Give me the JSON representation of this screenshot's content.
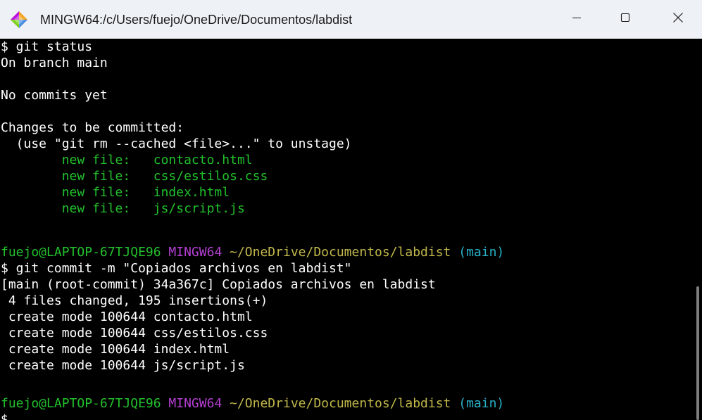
{
  "window": {
    "title": "MINGW64:/c/Users/fuejo/OneDrive/Documentos/labdist",
    "app_icon": "git-bash-icon",
    "controls": {
      "minimize": "minimize-icon",
      "maximize": "maximize-icon",
      "close": "close-icon"
    }
  },
  "colors": {
    "terminal_bg": "#000000",
    "text": "#ffffff",
    "green": "#22c02c",
    "magenta": "#b43fd2",
    "yellow": "#c2b84a",
    "cyan": "#27b1c9",
    "titlebar_bg": "#eef2f6"
  },
  "terminal": {
    "lines": [
      {
        "text": "$ git status"
      },
      {
        "text": "On branch main"
      },
      {
        "text": ""
      },
      {
        "text": "No commits yet"
      },
      {
        "text": ""
      },
      {
        "text": "Changes to be committed:"
      },
      {
        "text": "  (use \"git rm --cached <file>...\" to unstage)"
      },
      {
        "text": "        new file:   contacto.html"
      },
      {
        "text": "        new file:   css/estilos.css"
      },
      {
        "text": "        new file:   index.html"
      },
      {
        "text": "        new file:   js/script.js"
      },
      {
        "text": ""
      },
      {
        "text": ""
      },
      {
        "prompt_user": "fuejo@LAPTOP-67TJQE96",
        "prompt_system": "MINGW64",
        "prompt_path": "~/OneDrive/Documentos/labdist",
        "prompt_branch": "(main)"
      },
      {
        "text": "$ git commit -m \"Copiados archivos en labdist\""
      },
      {
        "text": "[main (root-commit) 34a367c] Copiados archivos en labdist"
      },
      {
        "text": " 4 files changed, 195 insertions(+)"
      },
      {
        "text": " create mode 100644 contacto.html"
      },
      {
        "text": " create mode 100644 css/estilos.css"
      },
      {
        "text": " create mode 100644 index.html"
      },
      {
        "text": " create mode 100644 js/script.js"
      },
      {
        "text": ""
      },
      {
        "prompt_user": "fuejo@LAPTOP-67TJQE96",
        "prompt_system": "MINGW64",
        "prompt_path": "~/OneDrive/Documentos/labdist",
        "prompt_branch": "(main)"
      },
      {
        "text": "$"
      }
    ]
  }
}
